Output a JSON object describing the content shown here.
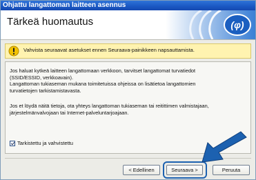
{
  "window": {
    "title": "Ohjattu langattoman laitteen asennus"
  },
  "header": {
    "title": "Tärkeä huomautus"
  },
  "notice": {
    "text": "Vahvista seuraavat asetukset ennen Seuraava-painikkeen napsauttamista."
  },
  "body": {
    "para1_line1": "Jos haluat kytkeä laitteen langattomaan verkkoon, tarvitset langattomat turvatiedot",
    "para1_line2": "(SSID/ESSID, verkkoavain).",
    "para2_line1": "Langattoman tukiaseman mukana toimitetuissa ohjeissa on lisätietoa langattomien",
    "para2_line2": "turvatietojen tarkistamistavasta.",
    "para3_line1": "Jos et löydä näitä tietoja, ota yhteys langattoman tukiaseman tai reitittimen valmistajaan,",
    "para3_line2": "järjestelmänvalvojaan tai Internet-palveluntarjoajaan."
  },
  "checkbox": {
    "label": "Tarkistettu ja vahvistettu",
    "checked": true
  },
  "buttons": {
    "back": "< Edellinen",
    "next": "Seuraava >",
    "cancel": "Peruuta"
  },
  "colors": {
    "titlebar": "#1a57c2",
    "notice_bg": "#fff3b0",
    "arrow": "#1c61b0"
  },
  "icons": {
    "header_logo": "wireless-icon",
    "notice": "warning-icon",
    "pointer": "arrow-icon"
  }
}
